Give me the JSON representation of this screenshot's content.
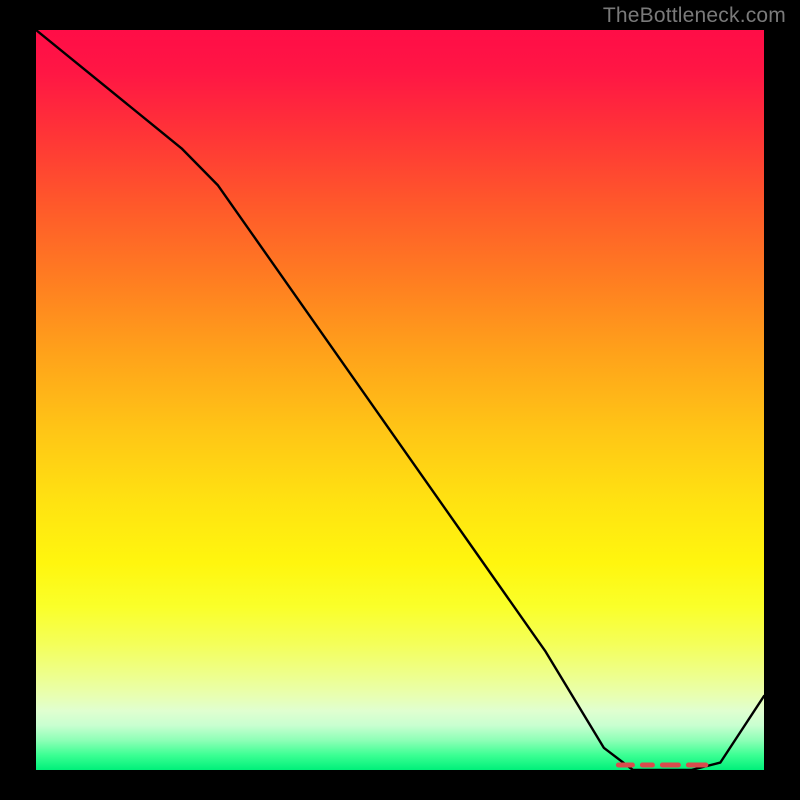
{
  "watermark": "TheBottleneck.com",
  "chart_data": {
    "type": "line",
    "title": "",
    "xlabel": "",
    "ylabel": "",
    "xlim": [
      0,
      100
    ],
    "ylim": [
      0,
      100
    ],
    "grid": false,
    "series": [
      {
        "name": "bottleneck-curve",
        "x": [
          0,
          10,
          20,
          25,
          30,
          40,
          50,
          60,
          70,
          78,
          82,
          86,
          90,
          94,
          100
        ],
        "y": [
          100,
          92,
          84,
          79,
          72,
          58,
          44,
          30,
          16,
          3,
          0,
          0,
          0,
          1,
          10
        ]
      }
    ],
    "highlight_range": {
      "name": "optimal-zone",
      "x_start": 80,
      "x_end": 92,
      "y": 0
    },
    "colors": {
      "top": "#ff0d47",
      "mid": "#fff60e",
      "bottom": "#00f07a",
      "curve": "#000000",
      "highlight": "#d94c4c"
    }
  }
}
